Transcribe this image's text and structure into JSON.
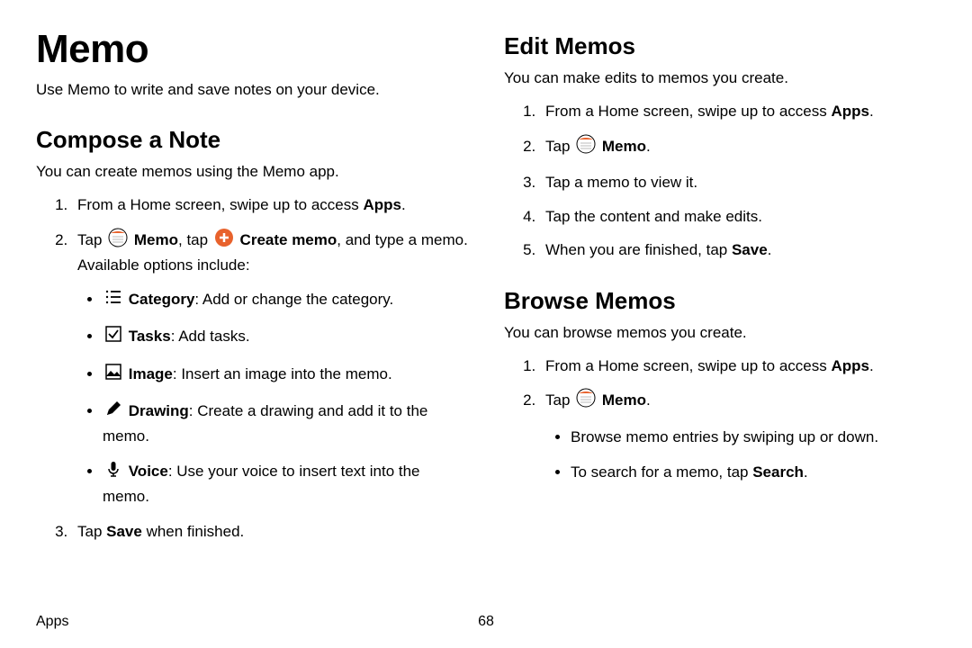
{
  "title": "Memo",
  "intro": "Use Memo to write and save notes on your device.",
  "compose": {
    "heading": "Compose a Note",
    "desc": "You can create memos using the Memo app.",
    "step1_a": "From a Home screen, swipe up to access ",
    "step1_b": "Apps",
    "step1_c": ".",
    "step2_a": "Tap ",
    "step2_b": "Memo",
    "step2_c": ", tap ",
    "step2_d": "Create memo",
    "step2_e": ", and type a memo. Available options include:",
    "opt_cat_b": "Category",
    "opt_cat_t": ": Add or change the category.",
    "opt_tasks_b": "Tasks",
    "opt_tasks_t": ": Add tasks.",
    "opt_image_b": "Image",
    "opt_image_t": ": Insert an image into the memo.",
    "opt_draw_b": "Drawing",
    "opt_draw_t": ": Create a drawing and add it to the memo.",
    "opt_voice_b": "Voice",
    "opt_voice_t": ": Use your voice to insert text into the memo.",
    "step3_a": "Tap ",
    "step3_b": "Save",
    "step3_c": " when finished."
  },
  "edit": {
    "heading": "Edit Memos",
    "desc": "You can make edits to memos you create.",
    "s1a": "From a Home screen, swipe up to access ",
    "s1b": "Apps",
    "s1c": ".",
    "s2a": "Tap ",
    "s2b": "Memo",
    "s2c": ".",
    "s3": "Tap a memo to view it.",
    "s4": "Tap the content and make edits.",
    "s5a": "When you are finished, tap ",
    "s5b": "Save",
    "s5c": "."
  },
  "browse": {
    "heading": "Browse Memos",
    "desc": "You can browse memos you create.",
    "s1a": "From a Home screen, swipe up to access ",
    "s1b": "Apps",
    "s1c": ".",
    "s2a": "Tap ",
    "s2b": "Memo",
    "s2c": ".",
    "b1": "Browse memo entries by swiping up or down.",
    "b2a": "To search for a memo, tap ",
    "b2b": "Search",
    "b2c": "."
  },
  "footer": {
    "label": "Apps",
    "page": "68"
  }
}
